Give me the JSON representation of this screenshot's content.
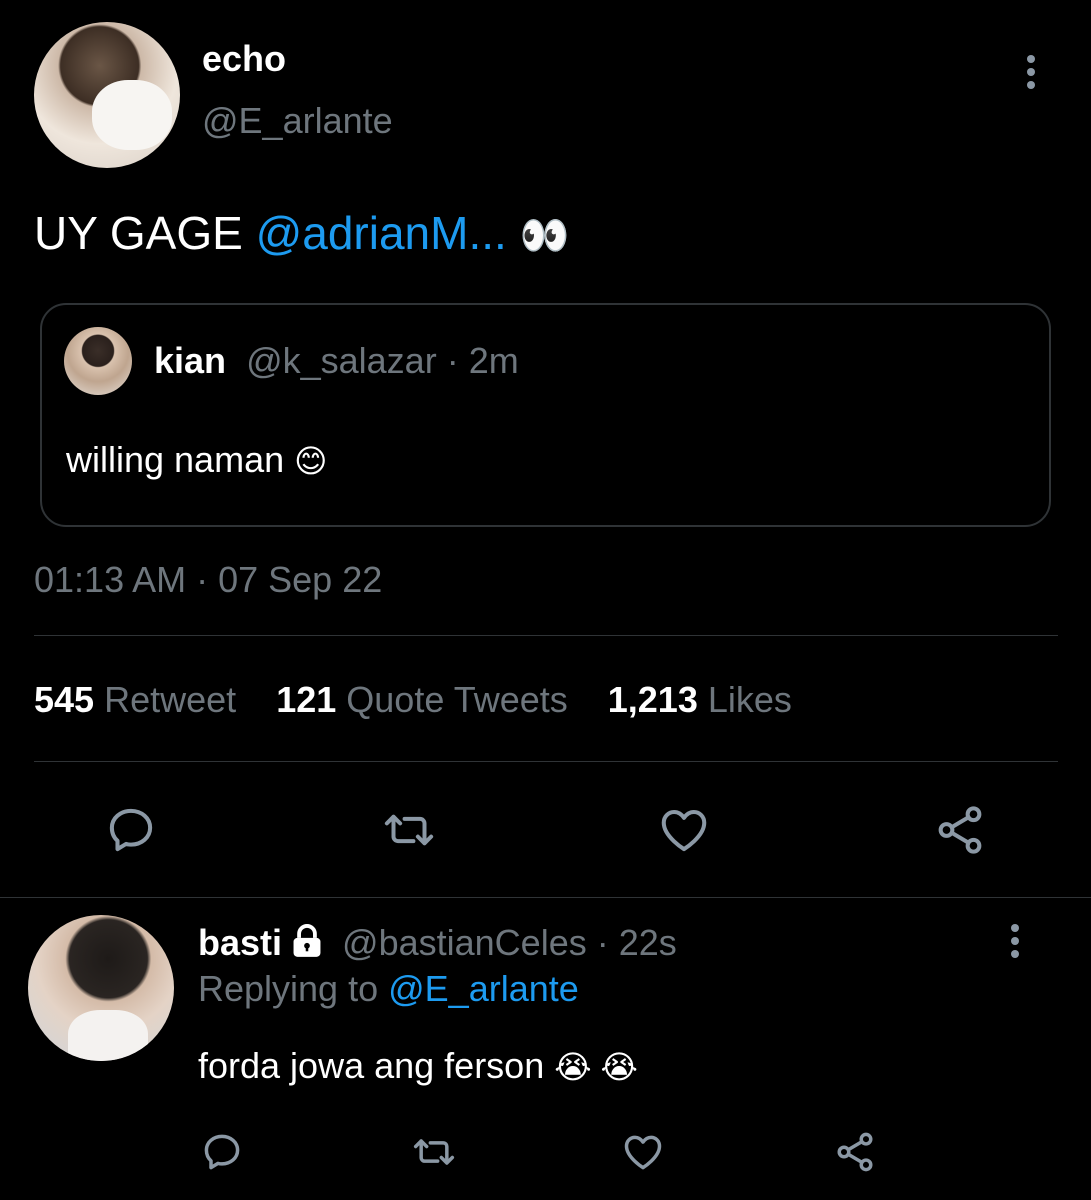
{
  "tweet": {
    "author": {
      "name": "echo",
      "handle": "@E_arlante"
    },
    "text_prefix": "UY GAGE ",
    "mention": "@adrianM...",
    "emoji": "👀",
    "quoted": {
      "name": "kian",
      "handle": "@k_salazar",
      "time": "· 2m",
      "text": "willing naman",
      "emoji": "😊"
    },
    "timestamp": "01:13 AM · 07 Sep 22",
    "stats": {
      "retweets_count": "545",
      "retweets_label": "Retweet",
      "quotes_count": "121",
      "quotes_label": "Quote Tweets",
      "likes_count": "1,213",
      "likes_label": "Likes"
    }
  },
  "reply": {
    "name": "basti",
    "handle": "@bastianCeles",
    "time": "· 22s",
    "replying_label": "Replying to",
    "replying_to": "@E_arlante",
    "text": "forda jowa ang ferson",
    "emoji": "😭 😭"
  },
  "icons": [
    "more-vertical-icon",
    "reply-icon",
    "retweet-icon",
    "like-icon",
    "share-icon",
    "lock-icon"
  ],
  "colors": {
    "background": "#000000",
    "link": "#1d9bf0",
    "secondary_text": "#6e767d",
    "divider": "#2f3336"
  }
}
